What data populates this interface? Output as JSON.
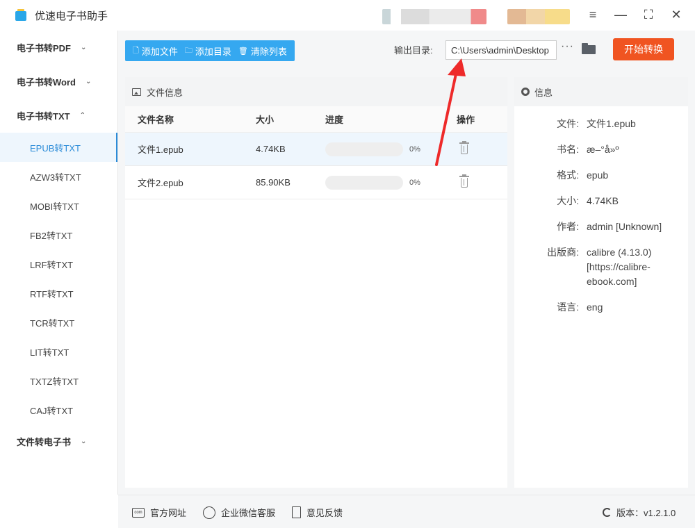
{
  "app": {
    "title": "优速电子书助手"
  },
  "sidebar": {
    "groups": [
      {
        "label": "电子书转PDF",
        "chevron": "chevron-down-icon"
      },
      {
        "label": "电子书转Word",
        "chevron": "chevron-down-icon"
      },
      {
        "label": "电子书转TXT",
        "chevron": "chevron-up-icon"
      }
    ],
    "items": [
      "EPUB转TXT",
      "AZW3转TXT",
      "MOBI转TXT",
      "FB2转TXT",
      "LRF转TXT",
      "RTF转TXT",
      "TCR转TXT",
      "LIT转TXT",
      "TXTZ转TXT",
      "CAJ转TXT"
    ],
    "active_item": "EPUB转TXT",
    "last_group": "文件转电子书"
  },
  "toolbar": {
    "add_file": "添加文件",
    "add_dir": "添加目录",
    "clear_list": "清除列表",
    "output_label": "输出目录:",
    "output_path": "C:\\Users\\admin\\Desktop",
    "more": "···",
    "start": "开始转换",
    "accent_color": "#35a8f0",
    "start_color": "#f05421"
  },
  "file_panel": {
    "title": "文件信息",
    "columns": {
      "name": "文件名称",
      "size": "大小",
      "progress": "进度",
      "action": "操作"
    },
    "rows": [
      {
        "name": "文件1.epub",
        "size": "4.74KB",
        "progress": 0,
        "progress_text": "0%"
      },
      {
        "name": "文件2.epub",
        "size": "85.90KB",
        "progress": 0,
        "progress_text": "0%"
      }
    ]
  },
  "info_panel": {
    "title": "信息",
    "fields": [
      {
        "k": "文件:",
        "v": "文件1.epub"
      },
      {
        "k": "书名:",
        "v": "æ–°å»º"
      },
      {
        "k": "格式:",
        "v": "epub"
      },
      {
        "k": "大小:",
        "v": "4.74KB"
      },
      {
        "k": "作者:",
        "v": "admin [Unknown]"
      },
      {
        "k": "出版商:",
        "v": "calibre (4.13.0) [https://calibre-ebook.com]"
      },
      {
        "k": "语言:",
        "v": "eng"
      }
    ]
  },
  "footer": {
    "website": "官方网址",
    "wechat": "企业微信客服",
    "feedback": "意见反馈",
    "version": "版本：v1.2.1.0"
  }
}
